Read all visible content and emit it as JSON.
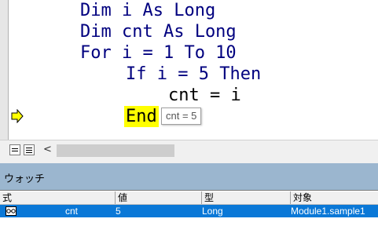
{
  "code": {
    "lines": [
      "Dim i As Long",
      "Dim cnt As Long",
      "For i = 1 To 10",
      "If i = 5 Then",
      "cnt = i",
      "End"
    ],
    "current_line_color": "#ffff00"
  },
  "tooltip": {
    "text": "cnt = 5"
  },
  "watch": {
    "title": "ウォッチ",
    "columns": [
      "式",
      "値",
      "型",
      "対象"
    ],
    "rows": [
      {
        "icon": "watch-glasses-icon",
        "expression": "cnt",
        "value": "5",
        "type": "Long",
        "context": "Module1.sample1"
      }
    ],
    "selected_color": "#0a78d7",
    "title_bar_color": "#9bb6cf"
  }
}
